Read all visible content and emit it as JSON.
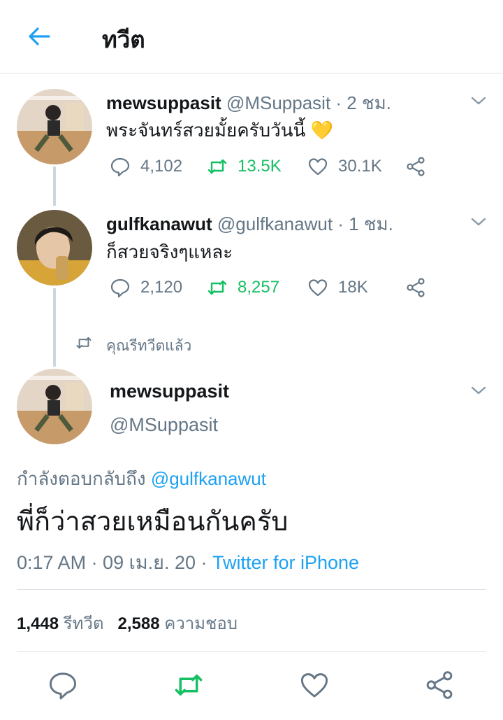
{
  "header": {
    "title": "ทวีต",
    "back_icon": "arrow-left-icon"
  },
  "tweets": [
    {
      "name": "mewsuppasit",
      "handle": "@MSuppasit",
      "time": " · 2 ชม.",
      "text": "พระจันทร์สวยมั้ยครับวันนี้ 💛",
      "replies": "4,102",
      "retweets": "13.5K",
      "likes": "30.1K"
    },
    {
      "name": "gulfkanawut",
      "handle": "@gulfkanawut",
      "time": " · 1 ชม.",
      "text": "ก็สวยจริงๆแหละ",
      "replies": "2,120",
      "retweets": "8,257",
      "likes": "18K"
    }
  ],
  "retweet_context": "คุณรีทวีตแล้ว",
  "main": {
    "name": "mewsuppasit",
    "handle": "@MSuppasit",
    "reply_prefix": "กำลังตอบกลับถึง ",
    "reply_to": "@gulfkanawut",
    "text": "พี่ก็ว่าสวยเหมือนกันครับ",
    "meta": "0:17 AM · 09 เม.ย. 20 · ",
    "source": "Twitter for iPhone",
    "retweet_count": "1,448",
    "retweet_label": " รีทวีต",
    "like_count": "2,588",
    "like_label": " ความชอบ"
  },
  "colors": {
    "accent": "#1da1f2",
    "retweet_green": "#17bf63",
    "muted": "#657786",
    "divider": "#dde3e8"
  }
}
